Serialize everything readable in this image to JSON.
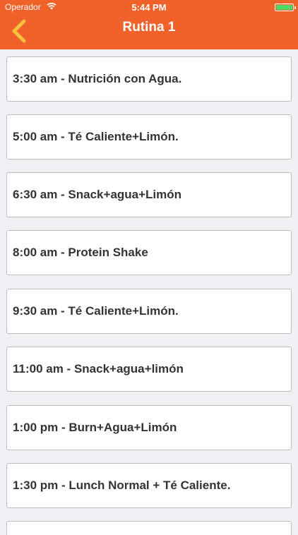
{
  "status_bar": {
    "carrier": "Operador",
    "time": "5:44 PM",
    "battery_color": "#4cd964"
  },
  "nav": {
    "title": "Rutina 1",
    "back_icon": "chevron-left-icon",
    "bar_color": "#f0622a",
    "back_icon_color": "#f7c13c"
  },
  "routine_items": [
    {
      "label": "3:30 am - Nutrición  con Agua."
    },
    {
      "label": "5:00 am - Té Caliente+Limón."
    },
    {
      "label": "6:30 am - Snack+agua+Limón"
    },
    {
      "label": "8:00 am - Protein Shake"
    },
    {
      "label": "9:30 am - Té Caliente+Limón."
    },
    {
      "label": "11:00 am - Snack+agua+limón"
    },
    {
      "label": "1:00 pm - Burn+Agua+Limón"
    },
    {
      "label": "1:30 pm - Lunch Normal + Té Caliente."
    }
  ]
}
